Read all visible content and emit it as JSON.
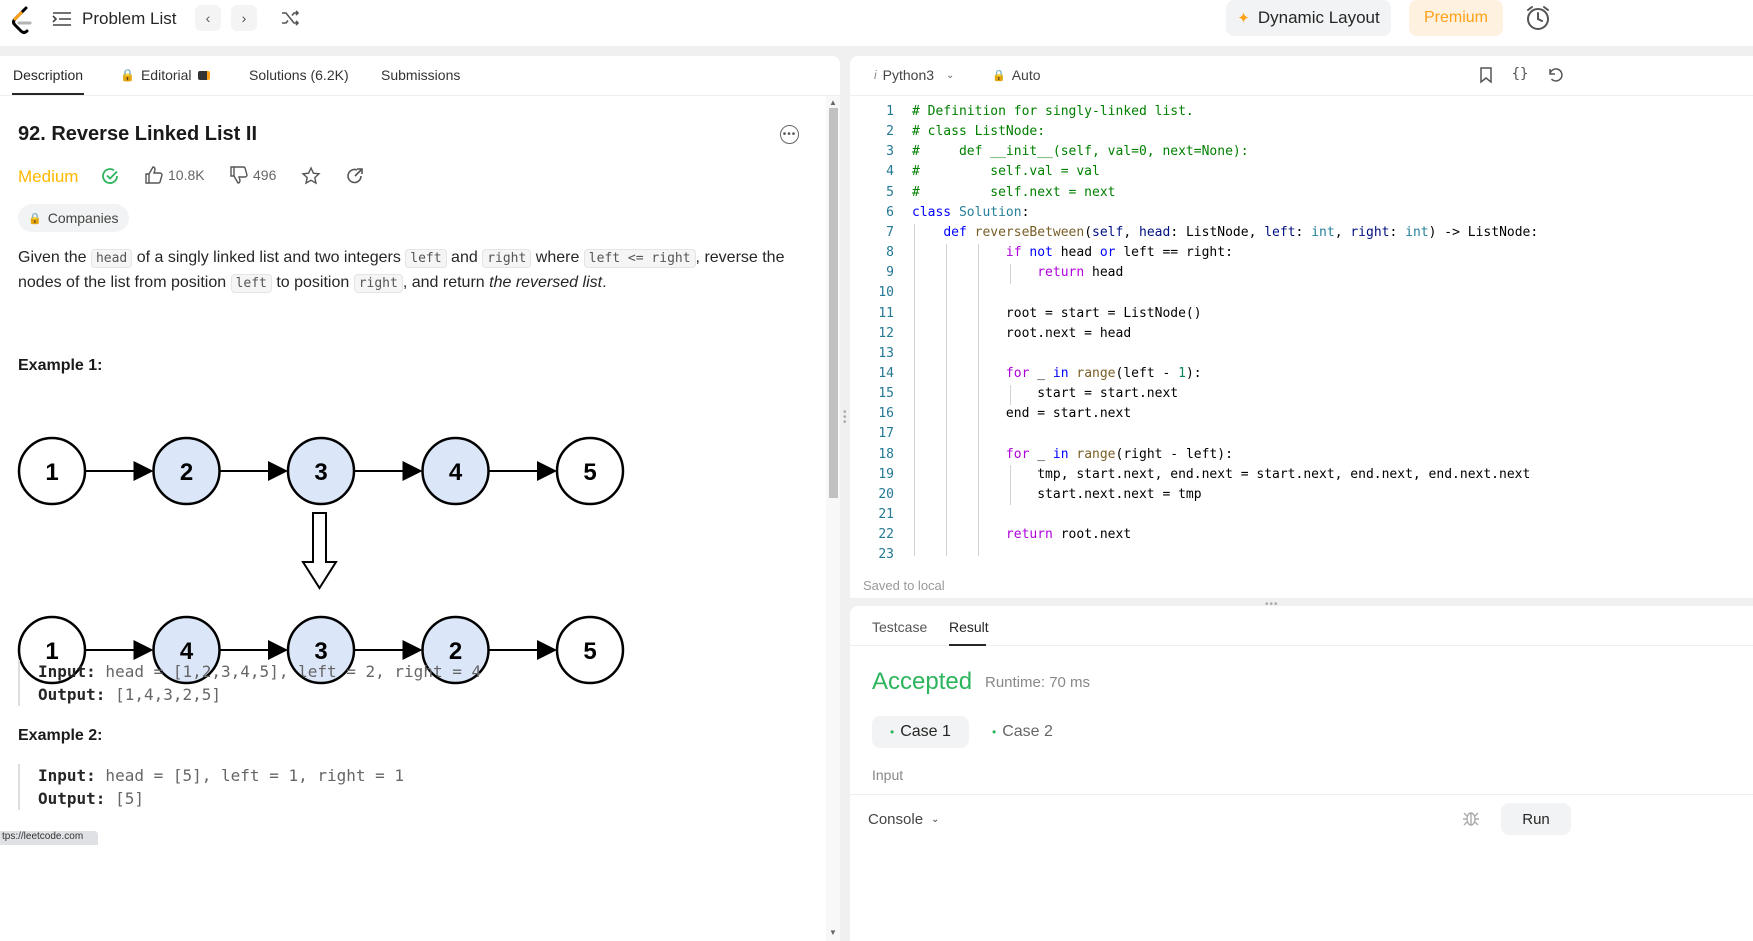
{
  "topbar": {
    "problem_list": "Problem List",
    "dynamic_layout": "Dynamic Layout",
    "premium": "Premium"
  },
  "tabs": [
    {
      "label": "Description"
    },
    {
      "label": "Editorial"
    },
    {
      "label": "Solutions (6.2K)"
    },
    {
      "label": "Submissions"
    }
  ],
  "problem": {
    "title": "92. Reverse Linked List II",
    "difficulty": "Medium",
    "likes": "10.8K",
    "dislikes": "496",
    "companies": "Companies",
    "desc_1": "Given the ",
    "code_head": "head",
    "desc_2": " of a singly linked list and two integers ",
    "code_left": "left",
    "desc_3": " and ",
    "code_right": "right",
    "desc_4": " where ",
    "code_cond": "left <= right",
    "desc_5": ", reverse the nodes of the list from position ",
    "desc_6": " to position ",
    "desc_7": ", and return ",
    "desc_italic": "the reversed list",
    "desc_8": "."
  },
  "example1": {
    "title": "Example 1:",
    "top_nodes": [
      "1",
      "2",
      "3",
      "4",
      "5"
    ],
    "bottom_nodes": [
      "1",
      "4",
      "3",
      "2",
      "5"
    ],
    "input_label": "Input:",
    "input_value": " head = [1,2,3,4,5], left = 2, right = 4",
    "output_label": "Output:",
    "output_value": " [1,4,3,2,5]"
  },
  "example2": {
    "title": "Example 2:",
    "input_label": "Input:",
    "input_value": " head = [5], left = 1, right = 1",
    "output_label": "Output:",
    "output_value": " [5]"
  },
  "status_url": "tps://leetcode.com",
  "editor": {
    "language": "Python3",
    "mode": "Auto",
    "saved": "Saved to local",
    "line_numbers": [
      "1",
      "2",
      "3",
      "4",
      "5",
      "6",
      "7",
      "8",
      "9",
      "10",
      "11",
      "12",
      "13",
      "14",
      "15",
      "16",
      "17",
      "18",
      "19",
      "20",
      "21",
      "22",
      "23"
    ]
  },
  "result": {
    "tab_testcase": "Testcase",
    "tab_result": "Result",
    "status": "Accepted",
    "runtime": "Runtime: 70 ms",
    "case1": "Case 1",
    "case2": "Case 2",
    "input_label": "Input",
    "console": "Console",
    "run": "Run"
  },
  "colors": {
    "accent": "#ffa116",
    "medium": "#ffb800",
    "accepted": "#2db55d",
    "node_highlight": "#dbe6f8"
  }
}
